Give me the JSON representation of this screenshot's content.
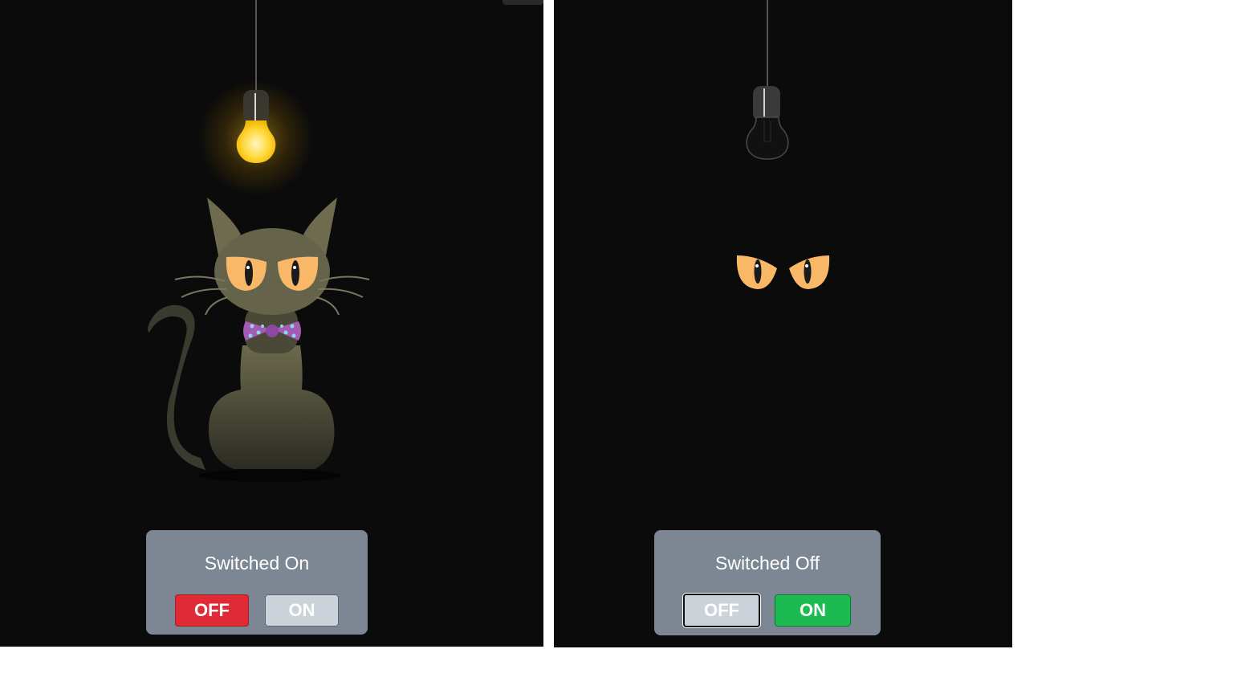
{
  "left_view": {
    "status": "Switched On",
    "buttons": {
      "off_label": "OFF",
      "on_label": "ON"
    },
    "bulb_state": "lit",
    "cat_visible": true
  },
  "right_view": {
    "status": "Switched Off",
    "buttons": {
      "off_label": "OFF",
      "on_label": "ON"
    },
    "bulb_state": "unlit",
    "cat_visible": false
  },
  "colors": {
    "background": "#0b0b0b",
    "control_box": "#7d8794",
    "off_active": "#e02a35",
    "on_active": "#1cbb52",
    "inactive_button": "#cbd2da",
    "cat_eye": "#f9b868",
    "bulb_glow": "#ffd43b",
    "bow_tie": "#a35bb4",
    "bow_dots": "#8fd6e8"
  }
}
